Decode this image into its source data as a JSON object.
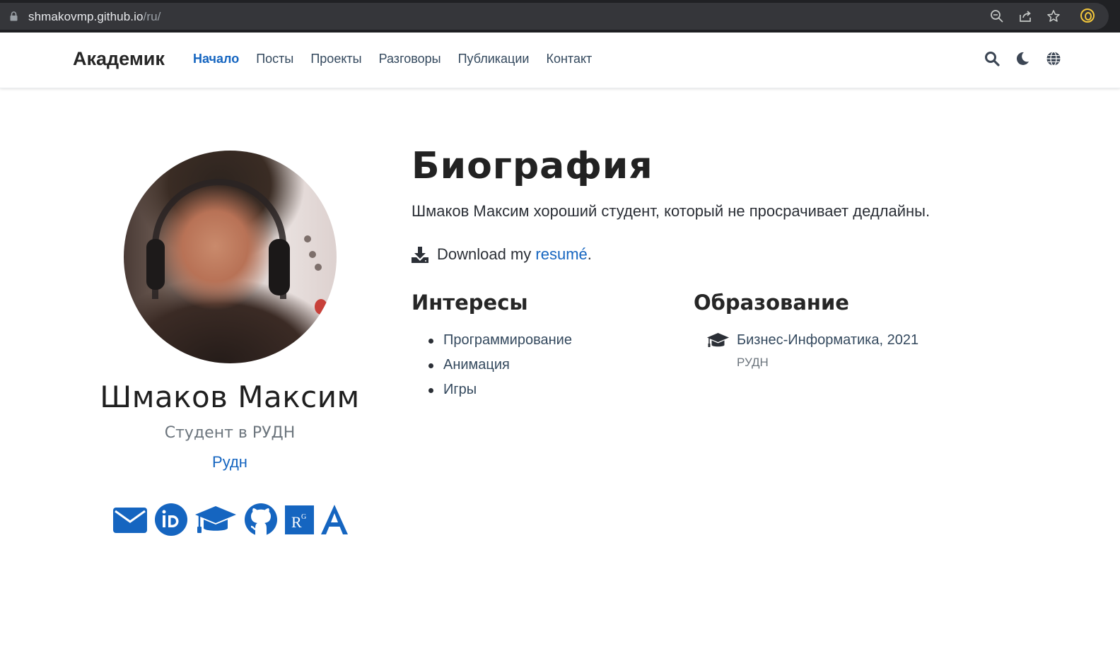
{
  "browser": {
    "url_host": "shmakovmp.github.io",
    "url_path": "/ru/"
  },
  "navbar": {
    "brand": "Академик",
    "links": [
      {
        "label": "Начало",
        "active": true
      },
      {
        "label": "Посты"
      },
      {
        "label": "Проекты"
      },
      {
        "label": "Разговоры"
      },
      {
        "label": "Публикации"
      },
      {
        "label": "Контакт"
      }
    ],
    "icons": [
      "search-icon",
      "moon-icon",
      "globe-icon"
    ]
  },
  "profile": {
    "name": "Шмаков Максим",
    "role": "Студент в РУДН",
    "organization": "Рудн",
    "social_icons": [
      "envelope-icon",
      "orcid-icon",
      "graduation-cap-icon",
      "github-icon",
      "researchgate-icon",
      "academia-icon"
    ]
  },
  "biography": {
    "title": "Биография",
    "text": "Шмаков Максим хороший студент, который не просрачивает дедлайны.",
    "download_prefix": "Download my ",
    "download_link": "resumé",
    "download_suffix": "."
  },
  "interests": {
    "title": "Интересы",
    "items": [
      "Программирование",
      "Анимация",
      "Игры"
    ]
  },
  "education": {
    "title": "Образование",
    "items": [
      {
        "degree": "Бизнес-Информатика, 2021",
        "institution": "РУДН"
      }
    ]
  },
  "colors": {
    "accent": "#1565c0",
    "text": "#2b2f36",
    "muted": "#6c757d"
  }
}
